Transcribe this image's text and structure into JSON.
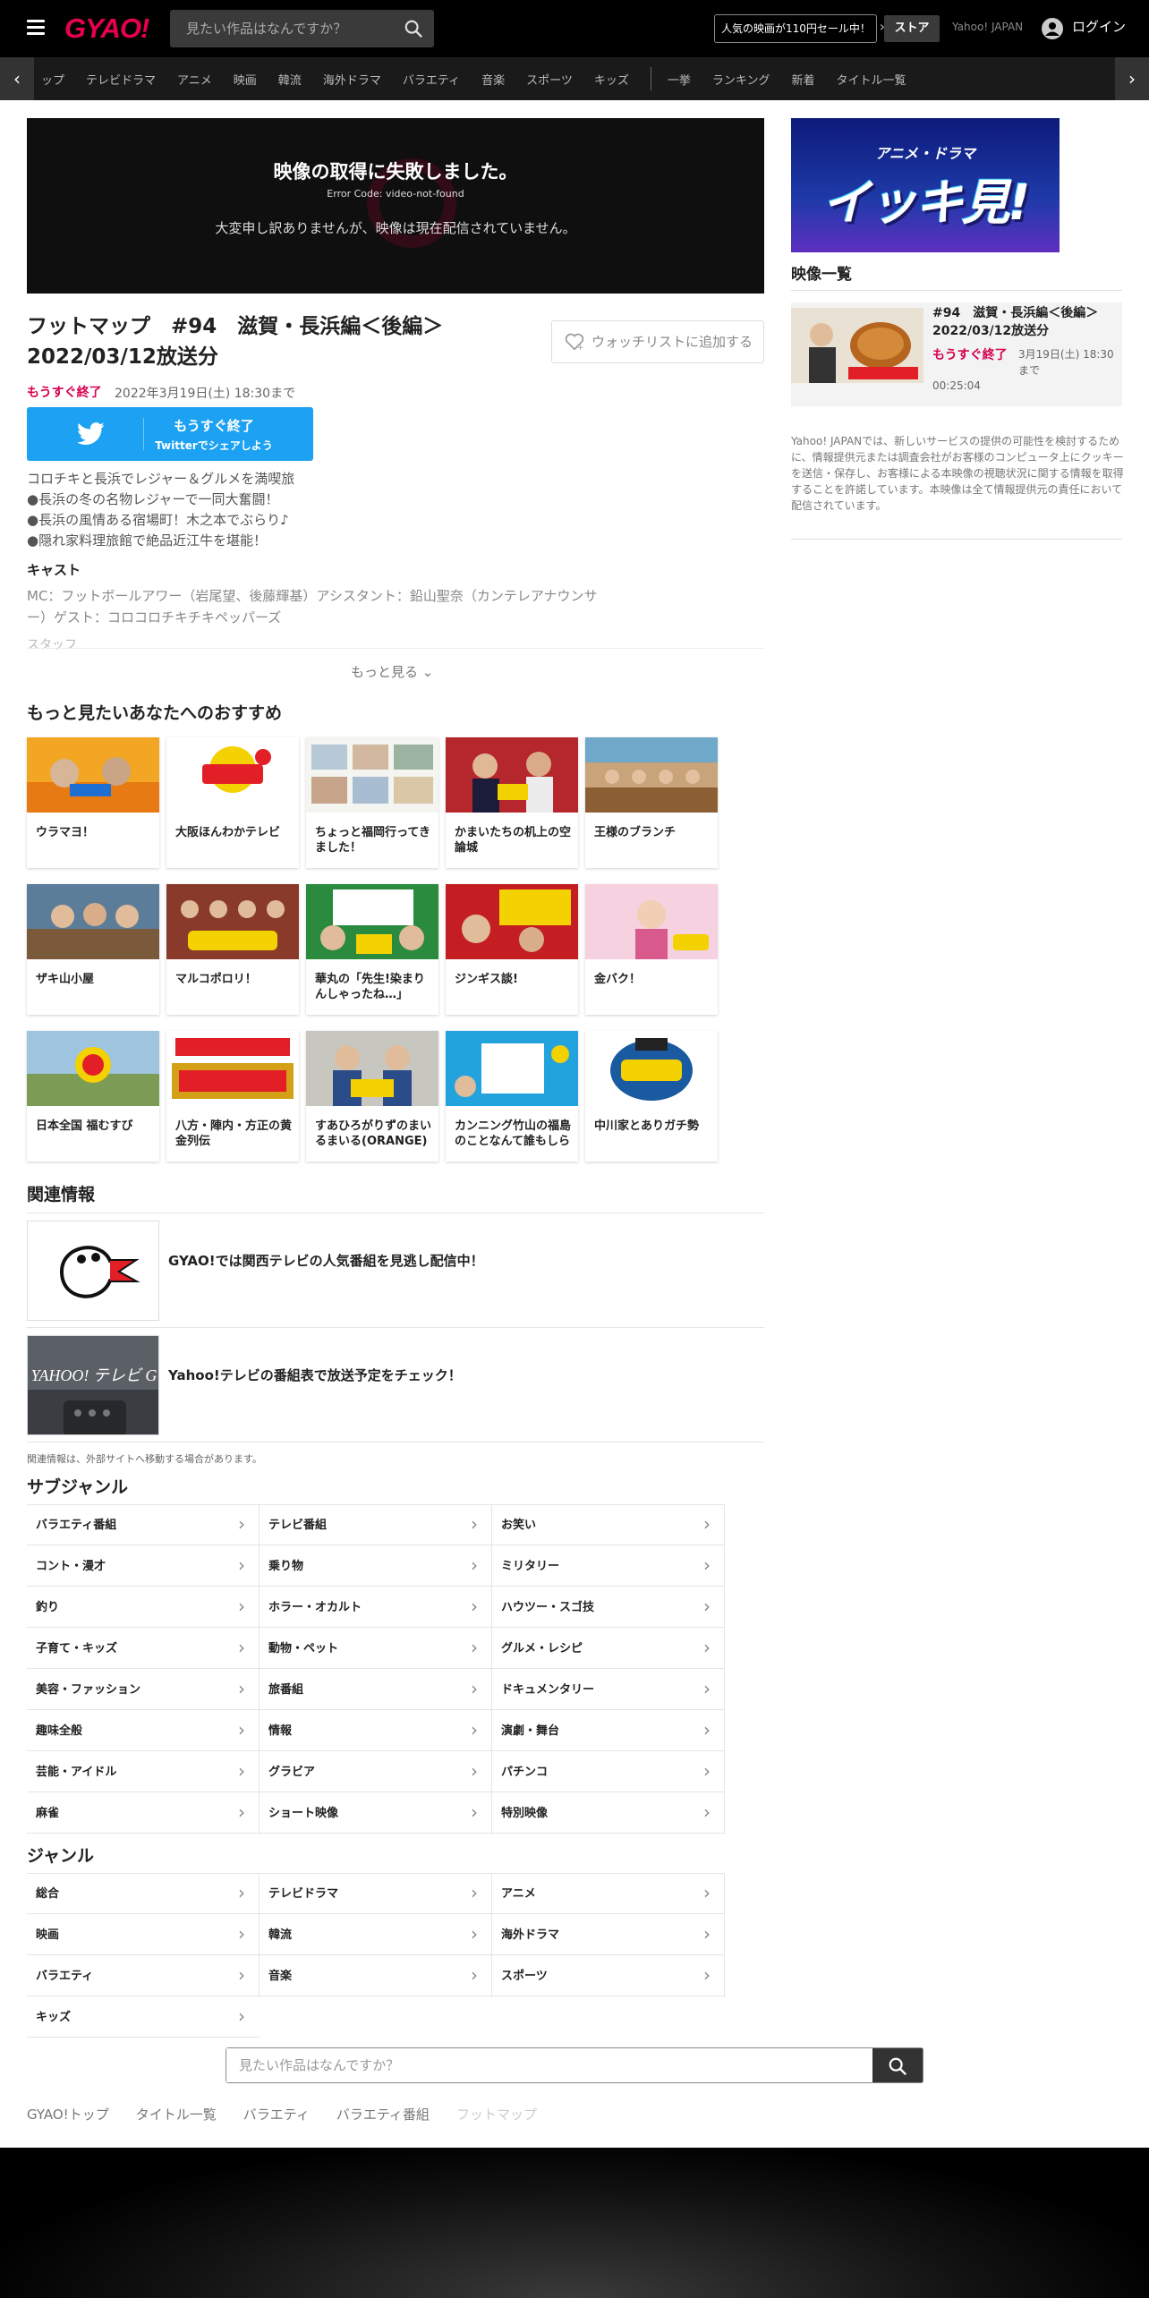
{
  "header": {
    "logo": "GYAO!",
    "search_placeholder": "見たい作品はなんですか？",
    "sale_banner": "人気の映画が110円セール中！",
    "store": "ストア",
    "yahoo_japan": "Yahoo! JAPAN",
    "login": "ログイン"
  },
  "nav": {
    "items": [
      "ップ",
      "テレビドラマ",
      "アニメ",
      "映画",
      "韓流",
      "海外ドラマ",
      "バラエティ",
      "音楽",
      "スポーツ",
      "キッズ"
    ],
    "items2": [
      "一挙",
      "ランキング",
      "新着",
      "タイトル一覧"
    ]
  },
  "player": {
    "error_title": "映像の取得に失敗しました。",
    "error_code": "Error Code: video-not-found",
    "error_message": "大変申し訳ありませんが、映像は現在配信されていません。"
  },
  "episode": {
    "title": "フットマップ　#94　滋賀・長浜編＜後編＞　2022/03/12放送分",
    "watchlist": "ウォッチリストに追加する",
    "soon_label": "もうすぐ終了",
    "end_date": "2022年3月19日(土) 18:30まで",
    "twitter_line1": "もうすぐ終了",
    "twitter_line2": "Twitterでシェアしよう",
    "description": [
      "コロチキと長浜でレジャー＆グルメを満喫旅",
      "●長浜の冬の名物レジャーで一同大奮闘！",
      "●長浜の風情ある宿場町！木之本でぶらり♪",
      "●隠れ家料理旅館で絶品近江牛を堪能！"
    ],
    "cast_heading": "キャスト",
    "cast_text": "MC：フットボールアワー（岩尾望、後藤輝基）アシスタント：鉛山聖奈（カンテレアナウンサー）ゲスト：コロコロチキチキペッパーズ",
    "staff_heading": "スタッフ",
    "more": "もっと見る"
  },
  "recommend": {
    "title": "もっと見たいあなたへのおすすめ",
    "items": [
      {
        "label": "ウラマヨ！"
      },
      {
        "label": "大阪ほんわかテレビ"
      },
      {
        "label": "ちょっと福岡行ってきました！"
      },
      {
        "label": "かまいたちの机上の空論城"
      },
      {
        "label": "王様のブランチ"
      },
      {
        "label": "ザキ山小屋"
      },
      {
        "label": "マルコポロリ！"
      },
      {
        "label": "華丸の「先生!染まりんしゃったね…」"
      },
      {
        "label": "ジンギス談!"
      },
      {
        "label": "金バク！"
      },
      {
        "label": "日本全国 福むすび"
      },
      {
        "label": "八方・陣内・方正の黄金列伝"
      },
      {
        "label": "すあひろがりずのまいるまいる(ORANGE)"
      },
      {
        "label": "カンニング竹山の福島のことなんて誰もしら"
      },
      {
        "label": "中川家とありガチ勢"
      }
    ]
  },
  "related": {
    "title": "関連情報",
    "items": [
      {
        "text": "GYAO!では関西テレビの人気番組を見逃し配信中！"
      },
      {
        "text": "Yahoo!テレビの番組表で放送予定をチェック！"
      }
    ],
    "note": "関連情報は、外部サイトへ移動する場合があります。"
  },
  "subgenre": {
    "title": "サブジャンル",
    "items": [
      "バラエティ番組",
      "テレビ番組",
      "お笑い",
      "コント・漫才",
      "乗り物",
      "ミリタリー",
      "釣り",
      "ホラー・オカルト",
      "ハウツー・スゴ技",
      "子育て・キッズ",
      "動物・ペット",
      "グルメ・レシピ",
      "美容・ファッション",
      "旅番組",
      "ドキュメンタリー",
      "趣味全般",
      "情報",
      "演劇・舞台",
      "芸能・アイドル",
      "グラビア",
      "パチンコ",
      "麻雀",
      "ショート映像",
      "特別映像"
    ]
  },
  "genre": {
    "title": "ジャンル",
    "items": [
      "総合",
      "テレビドラマ",
      "アニメ",
      "映画",
      "韓流",
      "海外ドラマ",
      "バラエティ",
      "音楽",
      "スポーツ",
      "キッズ"
    ]
  },
  "bottom_search": {
    "placeholder": "見たい作品はなんですか？"
  },
  "breadcrumbs": [
    "GYAO!トップ",
    "タイトル一覧",
    "バラエティ",
    "バラエティ番組",
    "フットマップ"
  ],
  "sidebar": {
    "banner_sub": "アニメ・ドラマ",
    "banner_main": "イッキ見!",
    "list_title": "映像一覧",
    "item": {
      "title": "#94　滋賀・長浜編＜後編＞　2022/03/12放送分",
      "soon": "もうすぐ終了",
      "date": "3月19日(土) 18:30まで",
      "duration": "00:25:04"
    },
    "note": "Yahoo! JAPANでは、新しいサービスの提供の可能性を検討するために、情報提供元または調査会社がお客様のコンピュータ上にクッキーを送信・保存し、お客様による本映像の視聴状況に関する情報を取得することを許諾しています。本映像は全て情報提供元の責任において配信されています。"
  },
  "colors": {
    "accent": "#e6004d",
    "soon": "#d6004f",
    "twitter": "#1da1f2"
  }
}
